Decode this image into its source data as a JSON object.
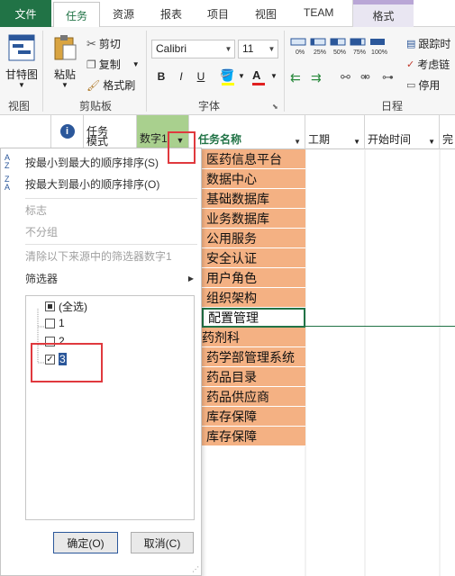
{
  "tabs": {
    "file": "文件",
    "task": "任务",
    "resource": "资源",
    "report": "报表",
    "project": "项目",
    "view": "视图",
    "team": "TEAM",
    "format": "格式"
  },
  "ribbon": {
    "view_group": {
      "gantt": "甘特图",
      "label": "视图"
    },
    "clipboard": {
      "paste": "粘贴",
      "cut": "剪切",
      "copy": "复制",
      "format_painter": "格式刷",
      "label": "剪贴板"
    },
    "font": {
      "name": "Calibri",
      "size": "11",
      "bold": "B",
      "italic": "I",
      "underline": "U",
      "label": "字体"
    },
    "schedule": {
      "pct": [
        "0%",
        "25%",
        "50%",
        "75%",
        "100%"
      ],
      "track": "跟踪时",
      "respect_links": "考虑链",
      "inactivate": "停用",
      "label": "日程"
    }
  },
  "grid": {
    "headers": {
      "task_mode": "任务\n模式",
      "number": "数字1",
      "task_name": "任务名称",
      "duration": "工期",
      "start": "开始时间",
      "finish": "完"
    },
    "tasks": [
      "医药信息平台",
      "数据中心",
      "基础数据库",
      "业务数据库",
      "公用服务",
      "安全认证",
      "用户角色",
      "组织架构",
      "配置管理",
      "药剂科",
      "药学部管理系统",
      "药品目录",
      "药品供应商",
      "库存保障",
      "库存保障"
    ]
  },
  "filter_menu": {
    "sort_asc": "按最小到最大的顺序排序(S)",
    "sort_desc": "按最大到最小的顺序排序(O)",
    "flag": "标志",
    "no_group": "不分组",
    "clear_filter": "清除以下来源中的筛选器数字1",
    "filters": "筛选器",
    "list": {
      "select_all": "(全选)",
      "items": [
        "1",
        "2",
        "3"
      ],
      "checked": "3"
    },
    "ok": "确定(O)",
    "cancel": "取消(C)"
  },
  "colors": {
    "accent_green": "#217346",
    "task_fill": "#f4b183",
    "highlight_red": "#e0393e"
  }
}
